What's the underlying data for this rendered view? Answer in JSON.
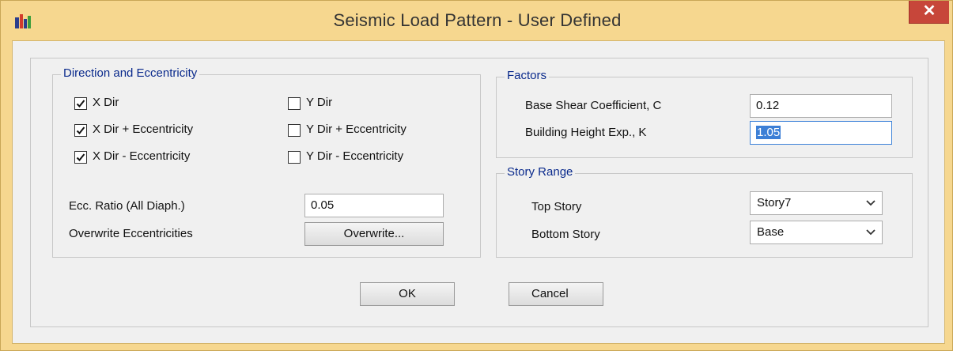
{
  "window": {
    "title": "Seismic Load Pattern - User Defined",
    "close_glyph": "✕"
  },
  "direction_group": {
    "title": "Direction and Eccentricity",
    "checkboxes": [
      {
        "label": "X Dir",
        "checked": true
      },
      {
        "label": "X Dir + Eccentricity",
        "checked": true
      },
      {
        "label": "X Dir - Eccentricity",
        "checked": true
      },
      {
        "label": "Y Dir",
        "checked": false
      },
      {
        "label": "Y Dir + Eccentricity",
        "checked": false
      },
      {
        "label": "Y Dir - Eccentricity",
        "checked": false
      }
    ],
    "ecc_ratio_label": "Ecc. Ratio (All Diaph.)",
    "ecc_ratio_value": "0.05",
    "overwrite_label": "Overwrite Eccentricities",
    "overwrite_button": "Overwrite..."
  },
  "factors_group": {
    "title": "Factors",
    "base_shear_label": "Base Shear Coefficient, C",
    "base_shear_value": "0.12",
    "height_exp_label": "Building Height Exp., K",
    "height_exp_value": "1.05"
  },
  "story_range_group": {
    "title": "Story Range",
    "top_story_label": "Top Story",
    "top_story_value": "Story7",
    "bottom_story_label": "Bottom Story",
    "bottom_story_value": "Base"
  },
  "buttons": {
    "ok": "OK",
    "cancel": "Cancel"
  },
  "colors": {
    "frame": "#f6d78f",
    "close": "#c7463a",
    "group_title": "#0a2a8c",
    "selection": "#3c7fd6"
  }
}
